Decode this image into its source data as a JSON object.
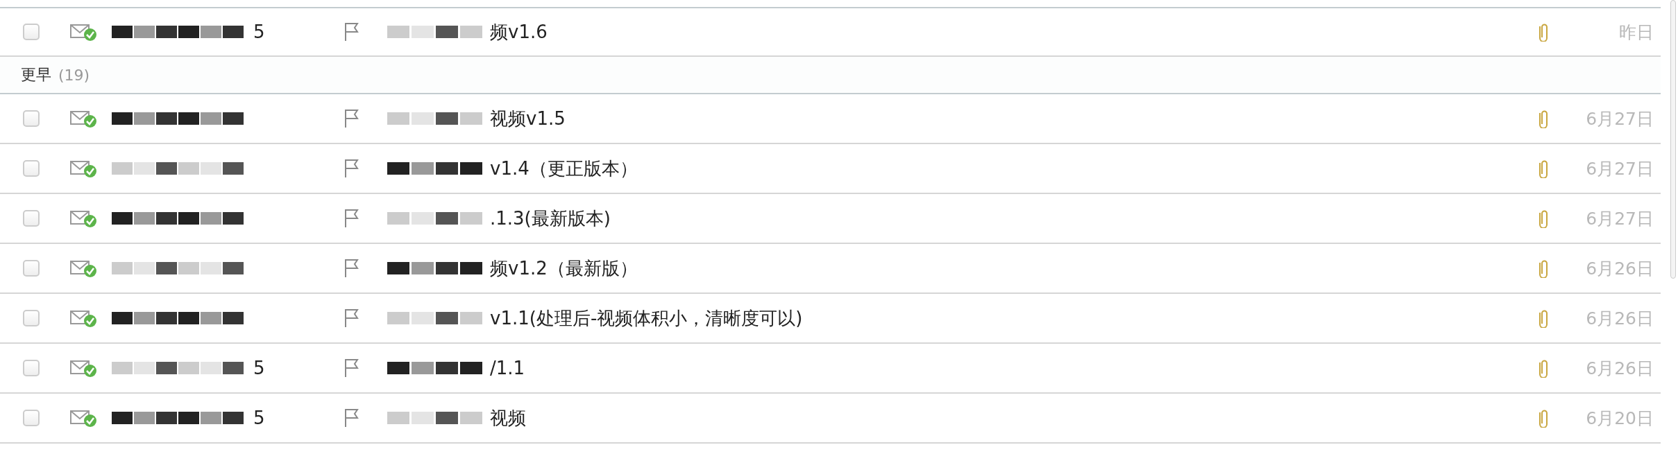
{
  "groups": [
    {
      "rows": [
        {
          "checked": false,
          "sender": "5",
          "subject": "频v1.6",
          "attachment": true,
          "date": "昨日"
        }
      ]
    },
    {
      "title": "更早",
      "count": "(19)",
      "rows": [
        {
          "checked": false,
          "sender": "",
          "subject": "视频v1.5",
          "attachment": true,
          "date": "6月27日"
        },
        {
          "checked": false,
          "sender": "",
          "subject": "v1.4（更正版本）",
          "attachment": true,
          "date": "6月27日"
        },
        {
          "checked": false,
          "sender": "",
          "subject": ".1.3(最新版本)",
          "attachment": true,
          "date": "6月27日"
        },
        {
          "checked": false,
          "sender": "",
          "subject": "频v1.2（最新版）",
          "attachment": true,
          "date": "6月26日"
        },
        {
          "checked": false,
          "sender": "",
          "subject": "v1.1(处理后-视频体积小，清晰度可以)",
          "attachment": true,
          "date": "6月26日"
        },
        {
          "checked": false,
          "sender": "5",
          "subject": "/1.1",
          "attachment": true,
          "date": "6月26日"
        },
        {
          "checked": false,
          "sender": "5",
          "subject": "视频",
          "attachment": true,
          "date": "6月20日"
        }
      ]
    }
  ]
}
